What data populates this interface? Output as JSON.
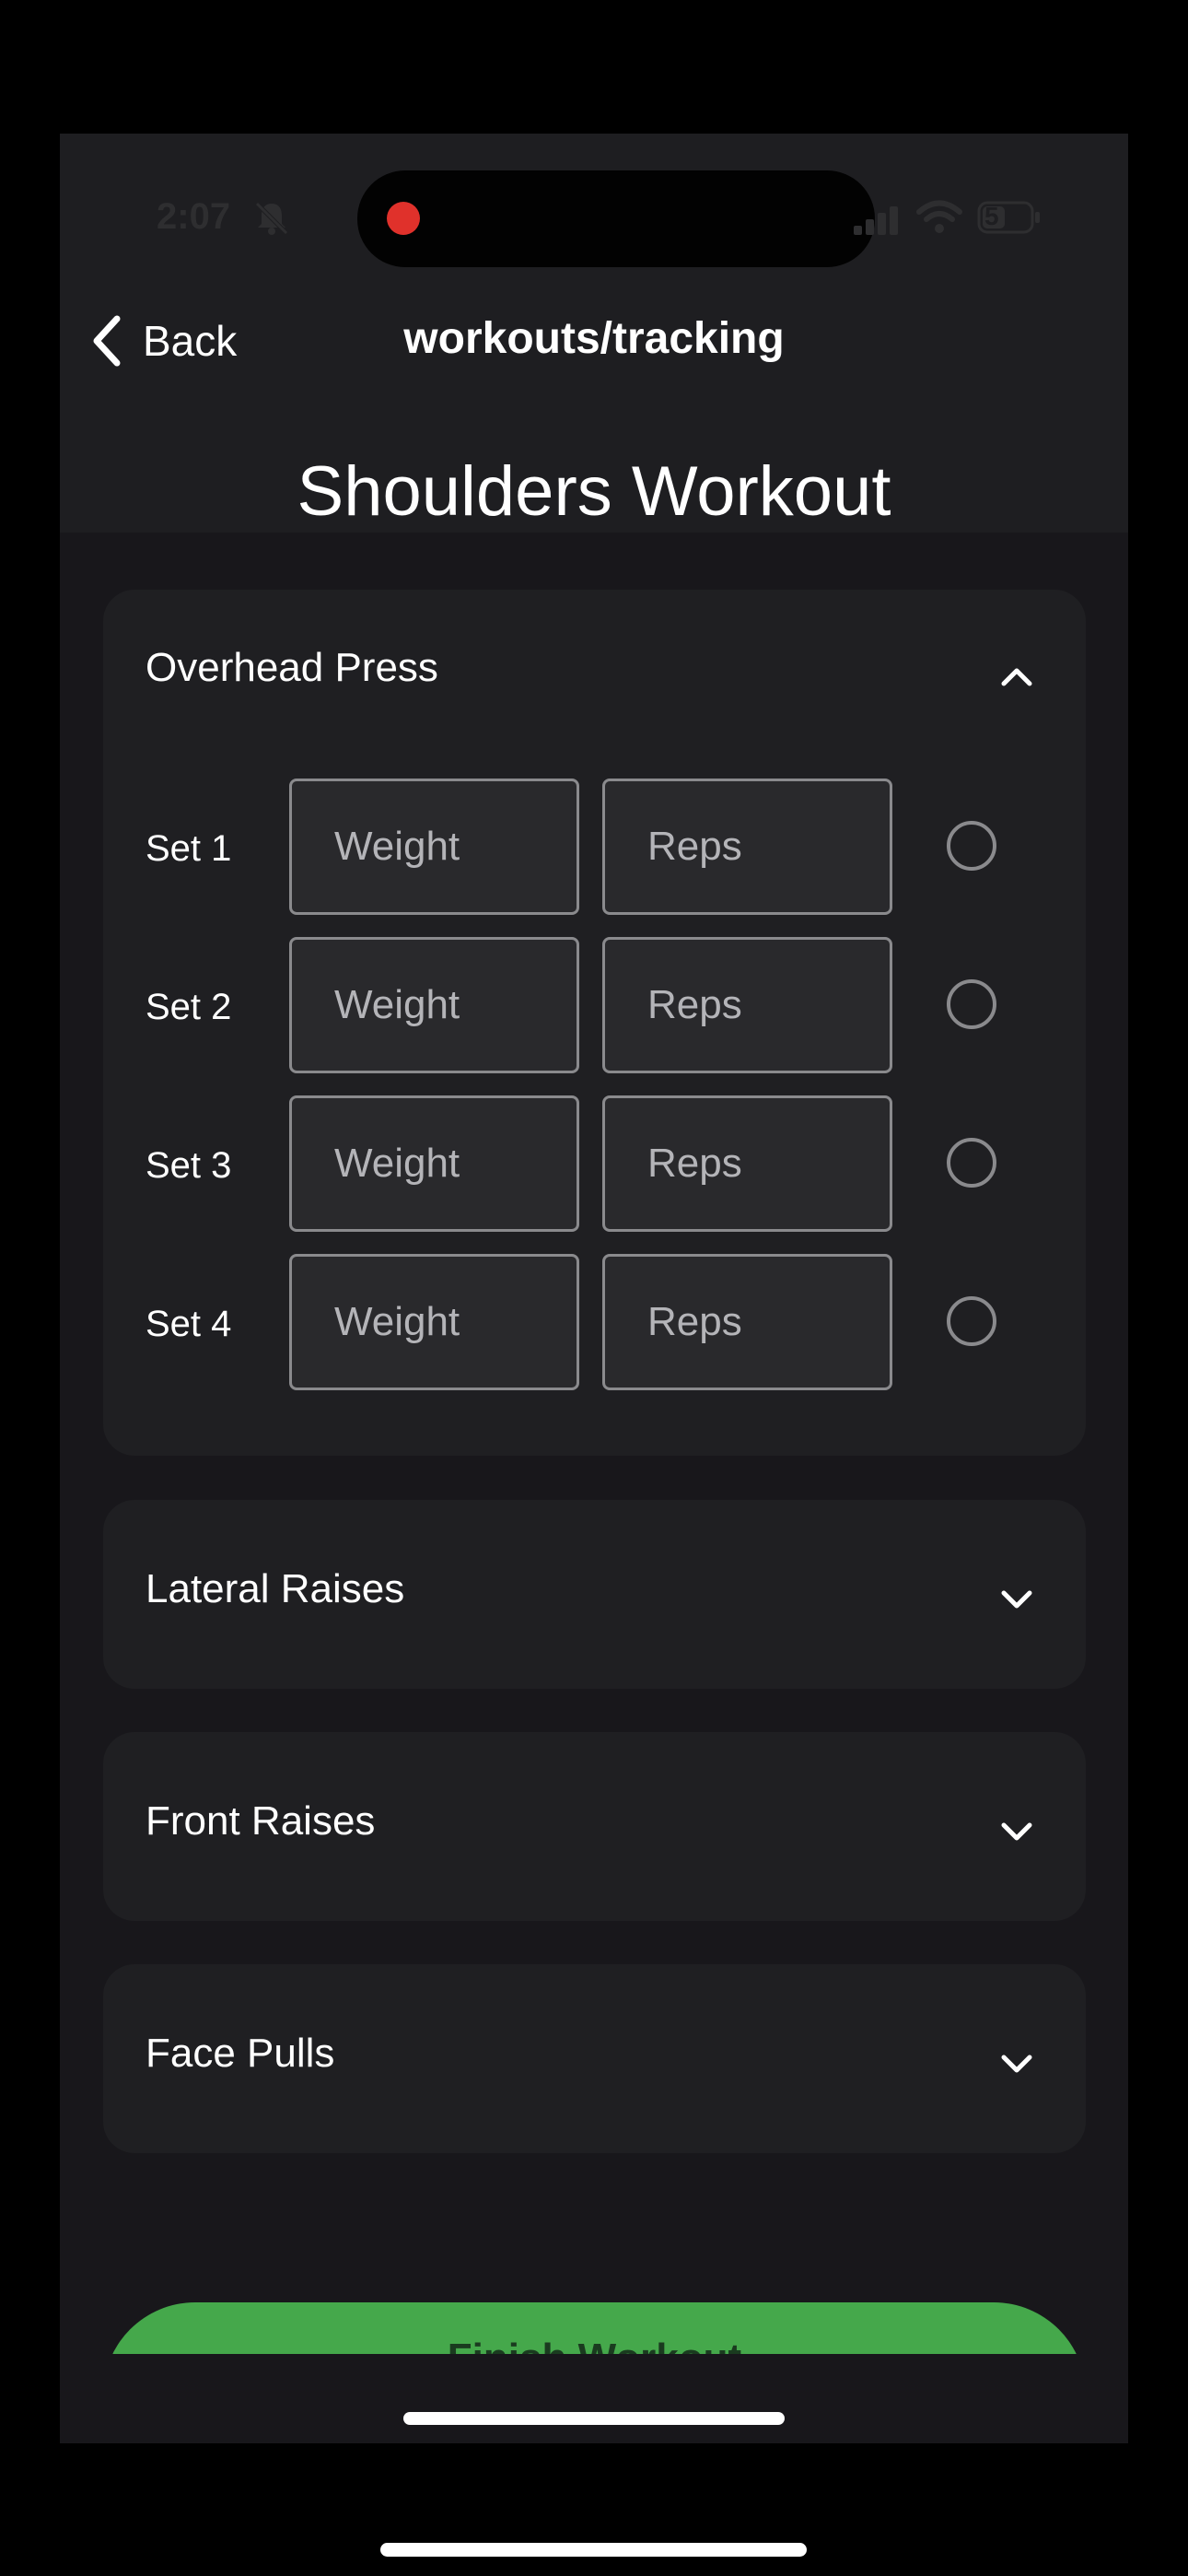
{
  "status_bar": {
    "time": "2:07",
    "battery": "5"
  },
  "nav": {
    "back_label": "Back",
    "title": "workouts/tracking"
  },
  "page": {
    "title": "Shoulders Workout"
  },
  "exercises": [
    {
      "name": "Overhead Press",
      "expanded": true,
      "sets": [
        {
          "label": "Set 1",
          "weight_placeholder": "Weight",
          "reps_placeholder": "Reps"
        },
        {
          "label": "Set 2",
          "weight_placeholder": "Weight",
          "reps_placeholder": "Reps"
        },
        {
          "label": "Set 3",
          "weight_placeholder": "Weight",
          "reps_placeholder": "Reps"
        },
        {
          "label": "Set 4",
          "weight_placeholder": "Weight",
          "reps_placeholder": "Reps"
        }
      ]
    },
    {
      "name": "Lateral Raises",
      "expanded": false
    },
    {
      "name": "Front Raises",
      "expanded": false
    },
    {
      "name": "Face Pulls",
      "expanded": false
    }
  ],
  "actions": {
    "finish_label": "Finish Workout"
  },
  "colors": {
    "background": "#18171b",
    "card": "#1f1f22",
    "accent": "#45a84b",
    "recording": "#e0312b"
  },
  "icons": [
    "bell-slash-icon",
    "signal-icon",
    "wifi-icon",
    "battery-icon",
    "chevron-left-icon",
    "chevron-up-icon",
    "chevron-down-icon",
    "circle-check-icon"
  ]
}
